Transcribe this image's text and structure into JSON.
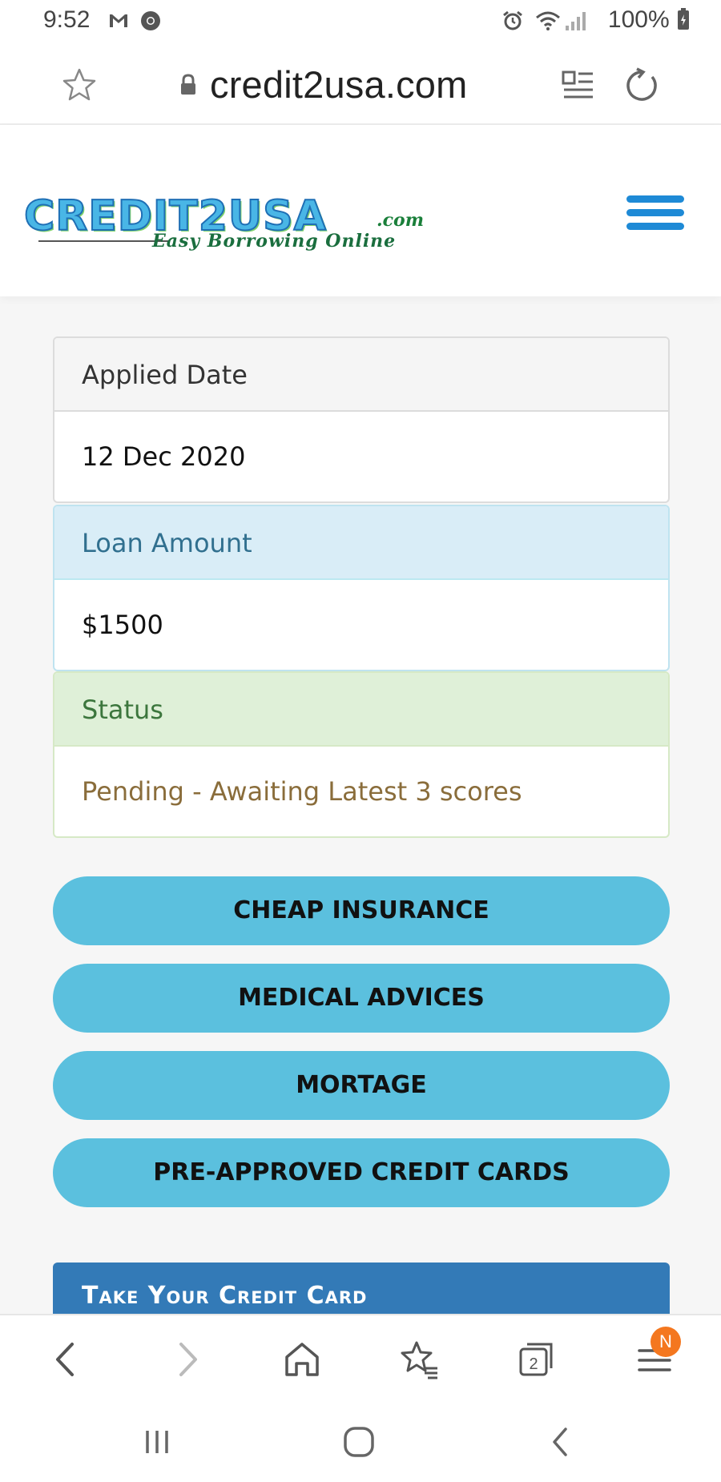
{
  "status_bar": {
    "time": "9:52",
    "battery": "100%",
    "icons": [
      "gmail-icon",
      "chrome-icon",
      "alarm-icon",
      "wifi-icon",
      "signal-icon",
      "battery-icon"
    ]
  },
  "address_bar": {
    "url": "credit2usa.com",
    "icons": [
      "star-icon",
      "lock-icon",
      "reader-mode-icon",
      "reload-icon"
    ]
  },
  "site_header": {
    "logo_text": "CREDIT2USA",
    "logo_domain": ".com",
    "logo_tagline": "Easy Borrowing Online",
    "menu_icon": "hamburger-menu-icon"
  },
  "panels": [
    {
      "heading": "Applied Date",
      "value": "12 Dec 2020"
    },
    {
      "heading": "Loan Amount",
      "value": "$1500"
    },
    {
      "heading": "Status",
      "value": "Pending - Awaiting Latest 3 scores"
    }
  ],
  "buttons": [
    {
      "label": "CHEAP INSURANCE"
    },
    {
      "label": "MEDICAL ADVICES"
    },
    {
      "label": "MORTAGE"
    },
    {
      "label": "PRE-APPROVED CREDIT CARDS"
    }
  ],
  "credit_banner": {
    "title": "Take Your Credit Card"
  },
  "browser_toolbar": {
    "icons": [
      "back-icon",
      "forward-icon",
      "home-icon",
      "bookmarks-icon",
      "tabs-icon",
      "menu-icon"
    ],
    "tab_count": "2",
    "menu_badge": "N"
  },
  "android_nav": {
    "icons": [
      "recents-icon",
      "home-circle-icon",
      "back-nav-icon"
    ]
  },
  "colors": {
    "pill_button": "#5bc0de",
    "banner": "#337ab7",
    "badge": "#f4771f"
  }
}
